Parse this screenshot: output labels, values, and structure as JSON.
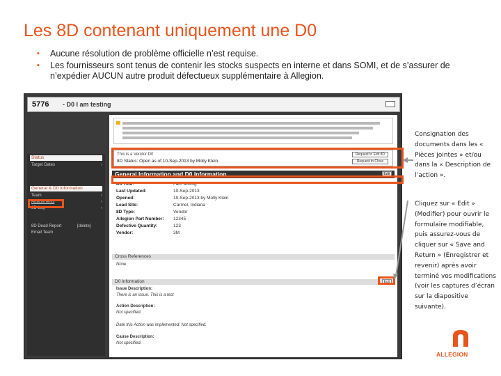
{
  "slide": {
    "title": "Les 8D contenant uniquement une D0",
    "bullets": [
      "Aucune résolution de problème officielle n’est requise.",
      "Les fournisseurs sont tenus de contenir les stocks suspects en interne et dans SOMI, et de s’assurer de n’expédier AUCUN autre produit défectueux supplémentaire à Allegion."
    ]
  },
  "app": {
    "record_id": "5776",
    "record_title": "- D0 I am testing",
    "status_line1": "This is a Vendor D0",
    "status_line2": "8D Status: Open as of 10-Sep-2013 by Molly Klein",
    "general_header": "General Information and D0 Information",
    "general_fields": [
      {
        "label": "D0 Title:",
        "value": "I am testing"
      },
      {
        "label": "Last Updated:",
        "value": "10-Sep-2013"
      },
      {
        "label": "Opened:",
        "value": "10-Sep-2013 by Molly Klein"
      },
      {
        "label": "Lead Site:",
        "value": "Carmel, Indiana"
      },
      {
        "label": "8D Type:",
        "value": "Vendor"
      },
      {
        "label": "Allegion Part Number:",
        "value": "12345"
      },
      {
        "label": "Defective Quantity:",
        "value": "123"
      },
      {
        "label": "Vendor:",
        "value": "3M"
      }
    ],
    "cross_ref_header": "Cross References",
    "cross_ref_value": "None",
    "d0_header": "D0 Information",
    "d0_lines": [
      {
        "text": "Issue Description:",
        "style": "b"
      },
      {
        "text": "There is an issue. This is a test",
        "style": "i"
      },
      {
        "text": "Action Description:",
        "style": "b"
      },
      {
        "text": "Not specified.",
        "style": "i"
      },
      {
        "text": "Date this Action was implemented: Not specified.",
        "style": "i"
      },
      {
        "text": "Cause Description:",
        "style": "b"
      },
      {
        "text": "Not specified.",
        "style": "i"
      }
    ],
    "edit_label": "Edit",
    "sidebar": {
      "status_label": "Status",
      "target_dates": "Target Dates",
      "section_label": "General & D0 Information",
      "team": "Team",
      "attachments": "Attachments",
      "log": "8D Log",
      "team_note": "8D Dead Report",
      "team_note_btn": "[delete]",
      "email_team": "Email Team"
    },
    "status_buttons": [
      "Request to Edit 8D",
      "Request to Close"
    ]
  },
  "callouts": {
    "first": "Consignation des documents dans les « Pièces jointes » et/ou dans la « Description de l’action ».",
    "second": "Cliquez sur « Edit » (Modifier) pour ouvrir le formulaire modifiable, puis assurez-vous de cliquer sur « Save and Return » (Enregistrer et revenir) après avoir terminé vos modifications (voir les captures d’écran sur la diapositive suivante)."
  },
  "brand": {
    "logo_text": "ALLEGION",
    "accent": "#e8541c"
  }
}
